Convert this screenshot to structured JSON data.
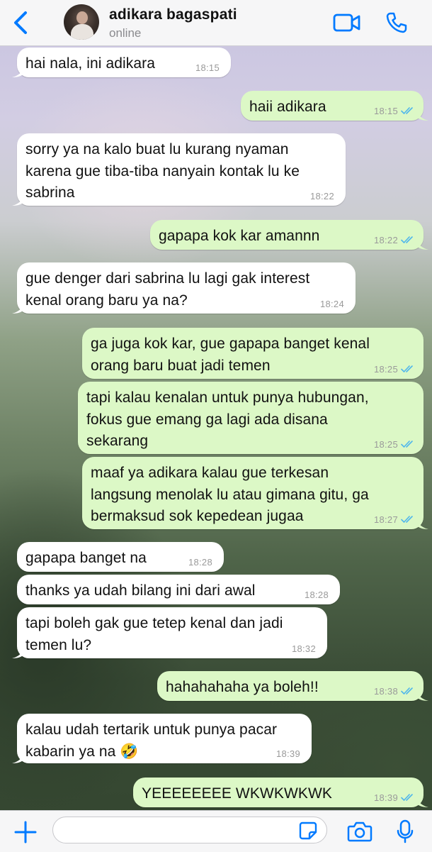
{
  "header": {
    "contact_name": "adikara bagaspati",
    "status": "online"
  },
  "messages": [
    {
      "dir": "in",
      "lines": [
        "hai nala, ini adikara"
      ],
      "time": "18:15"
    },
    {
      "dir": "out",
      "lines": [
        "haii adikara"
      ],
      "time": "18:15",
      "read": true
    },
    {
      "dir": "in",
      "lines": [
        "sorry ya na kalo buat lu kurang nyaman",
        "karena gue tiba-tiba nanyain kontak lu ke",
        "sabrina"
      ],
      "time": "18:22"
    },
    {
      "dir": "out",
      "lines": [
        "gapapa kok kar amannn"
      ],
      "time": "18:22",
      "read": true
    },
    {
      "dir": "in",
      "lines": [
        "gue denger dari sabrina lu lagi gak interest",
        "kenal orang baru ya na?"
      ],
      "time": "18:24"
    },
    {
      "dir": "out",
      "lines": [
        "ga juga kok kar, gue gapapa banget kenal",
        "orang baru buat jadi temen"
      ],
      "time": "18:25",
      "read": true
    },
    {
      "dir": "out",
      "lines": [
        "tapi kalau kenalan untuk punya hubungan,",
        "fokus gue emang ga lagi ada disana",
        "sekarang"
      ],
      "time": "18:25",
      "read": true
    },
    {
      "dir": "out",
      "lines": [
        "maaf ya adikara kalau gue terkesan",
        "langsung menolak lu atau gimana gitu, ga",
        "bermaksud sok kepedean jugaa"
      ],
      "time": "18:27",
      "read": true
    },
    {
      "dir": "in",
      "lines": [
        "gapapa banget na"
      ],
      "time": "18:28"
    },
    {
      "dir": "in",
      "lines": [
        "thanks ya udah bilang ini dari awal"
      ],
      "time": "18:28"
    },
    {
      "dir": "in",
      "lines": [
        "tapi boleh gak gue tetep kenal dan jadi",
        "temen lu?"
      ],
      "time": "18:32"
    },
    {
      "dir": "out",
      "lines": [
        "hahahahaha ya boleh!!"
      ],
      "time": "18:38",
      "read": true
    },
    {
      "dir": "in",
      "lines": [
        "kalau udah tertarik untuk punya pacar",
        "kabarin ya na 🤣"
      ],
      "time": "18:39"
    },
    {
      "dir": "out",
      "lines": [
        "YEEEEEEEE WKWKWKWK"
      ],
      "time": "18:39",
      "read": true
    }
  ],
  "composer": {
    "input_value": "",
    "placeholder": ""
  },
  "colors": {
    "accent": "#007aff",
    "bubble_out": "#dcf8c6",
    "bubble_in": "#ffffff",
    "read_ticks": "#4fb6ec"
  },
  "icons": {
    "back": "chevron-left-icon",
    "video": "video-camera-icon",
    "call": "phone-icon",
    "plus": "plus-icon",
    "sticker": "sticker-icon",
    "camera": "camera-icon",
    "mic": "microphone-icon"
  }
}
